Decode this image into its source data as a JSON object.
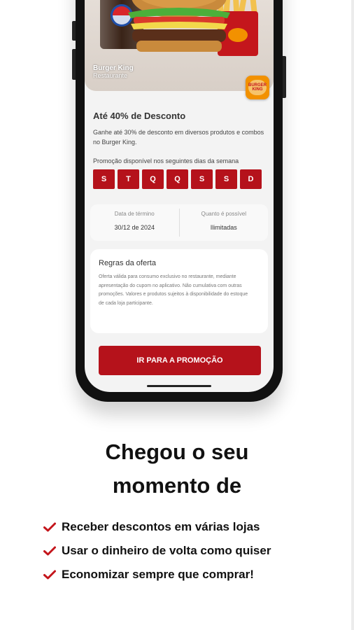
{
  "colors": {
    "accent": "#b5121b",
    "phone_body": "#111111",
    "screen_bg": "#f3f3f3"
  },
  "promo_screen": {
    "hero_caption_title": "Burger King",
    "hero_caption_sub": "Restaurante",
    "brand_logo_text": "BURGER KING",
    "offer_title": "Até 40% de Desconto",
    "offer_description": "Ganhe até 30% de desconto em diversos produtos e combos no Burger King.",
    "days_label": "Promoção disponível nos seguintes dias da semana",
    "days": [
      "S",
      "T",
      "Q",
      "Q",
      "S",
      "S",
      "D"
    ],
    "info": [
      {
        "label": "Data de término",
        "value": "30/12 de 2024"
      },
      {
        "label": "Quanto é possível",
        "value": "Ilimitadas"
      }
    ],
    "rules_title": "Regras da oferta",
    "rules_text": "Oferta válida para consumo exclusivo no restaurante, mediante apresentação do cupom no aplicativo. Não cumulativa com outras promoções. Valores e produtos sujeitos à disponibilidade do estoque de cada loja participante.",
    "cta_label": "IR PARA A PROMOÇÃO"
  },
  "headline": {
    "line1": "Chegou o seu",
    "line2": "momento de"
  },
  "benefits": [
    "Receber descontos em várias lojas",
    "Usar o dinheiro de volta como quiser",
    "Economizar sempre que comprar!"
  ]
}
